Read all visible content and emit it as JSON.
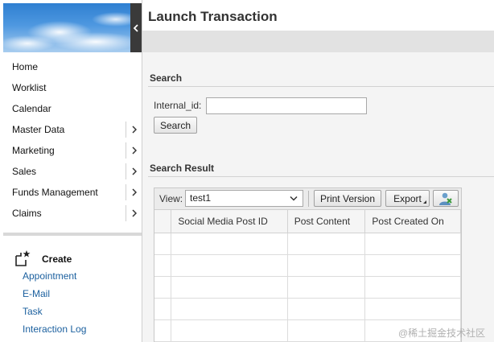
{
  "sidebar": {
    "nav_items": [
      {
        "label": "Home",
        "has_arrow": false
      },
      {
        "label": "Worklist",
        "has_arrow": false
      },
      {
        "label": "Calendar",
        "has_arrow": false
      },
      {
        "label": "Master Data",
        "has_arrow": true
      },
      {
        "label": "Marketing",
        "has_arrow": true
      },
      {
        "label": "Sales",
        "has_arrow": true
      },
      {
        "label": "Funds Management",
        "has_arrow": true
      },
      {
        "label": "Claims",
        "has_arrow": true
      }
    ],
    "create": {
      "title": "Create",
      "links": [
        "Appointment",
        "E-Mail",
        "Task",
        "Interaction Log"
      ]
    }
  },
  "main": {
    "page_title": "Launch Transaction",
    "search": {
      "section_title": "Search",
      "field_label": "Internal_id:",
      "field_value": "",
      "button_label": "Search"
    },
    "result": {
      "section_title": "Search Result",
      "view_label": "View:",
      "view_value": "test1",
      "print_label": "Print Version",
      "export_label": "Export",
      "columns": [
        "Social Media Post ID",
        "Post Content",
        "Post Created On"
      ],
      "empty_rows": 5
    }
  },
  "watermark": "@稀土掘金技术社区",
  "colors": {
    "link": "#1a5f9e",
    "collapse_bar": "#3a3a3a",
    "main_bg": "#f4f4f4"
  }
}
